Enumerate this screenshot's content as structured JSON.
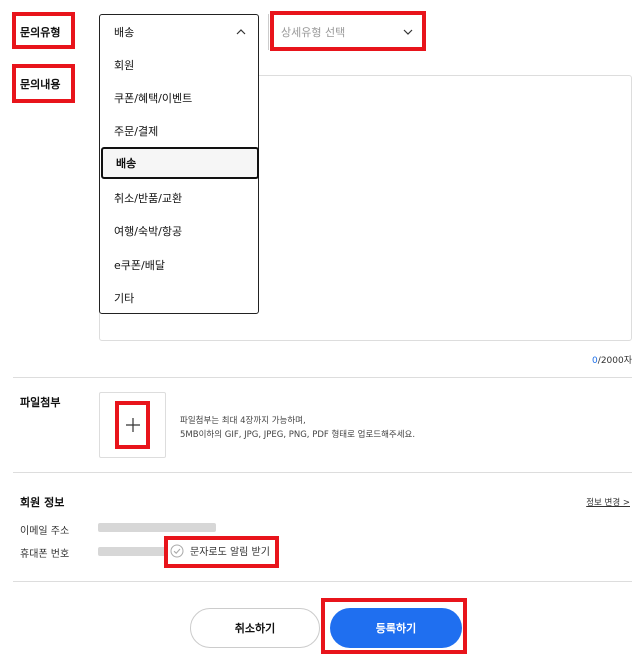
{
  "labels": {
    "inquiry_type": "문의유형",
    "inquiry_content": "문의내용",
    "attachment": "파일첨부",
    "member_info": "회원 정보",
    "email": "이메일 주소",
    "phone": "휴대폰 번호"
  },
  "dropdown": {
    "selected": "배송",
    "options": [
      "회원",
      "쿠폰/혜택/이벤트",
      "주문/결제",
      "배송",
      "취소/반품/교환",
      "여행/숙박/항공",
      "e쿠폰/배달",
      "기타"
    ]
  },
  "detail_select": {
    "placeholder": "상세유형 선택"
  },
  "counter": {
    "current": "0",
    "max": "/2000자"
  },
  "attachment_note": {
    "line1": "파일첨부는 최대 4장까지 가능하며,",
    "line2": "5MB이하의 GIF, JPG, JPEG, PNG, PDF 형태로 업로드해주세요."
  },
  "member": {
    "change_link": "정보 변경 >",
    "sms_label": "문자로도 알림 받기"
  },
  "buttons": {
    "cancel": "취소하기",
    "submit": "등록하기"
  },
  "colors": {
    "accent": "#1f6ff0",
    "highlight": "#e8141b"
  }
}
